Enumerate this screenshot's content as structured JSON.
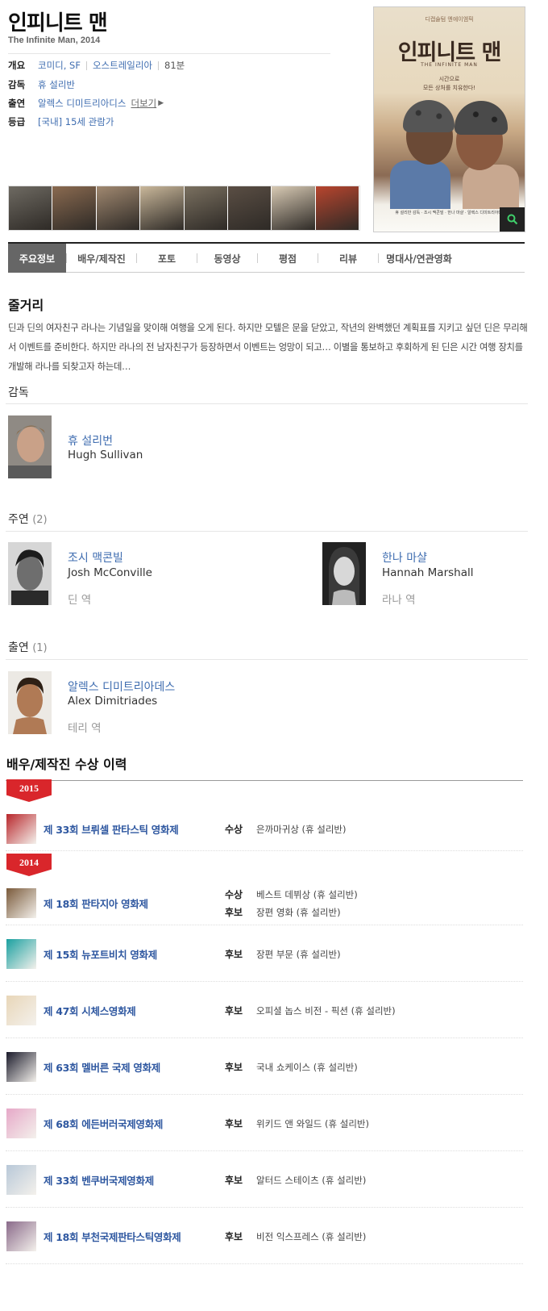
{
  "header": {
    "title": "인피니트 맨",
    "subtitle": "The Infinite Man, 2014"
  },
  "info": {
    "overview_label": "개요",
    "genre": "코미디, SF",
    "country": "오스트레일리아",
    "runtime": "81분",
    "director_label": "감독",
    "director": "휴 설리반",
    "cast_label": "출연",
    "cast": "알렉스 디미트리아디스",
    "more": "더보기",
    "rating_label": "등급",
    "rating": "[국내] 15세 관람가"
  },
  "poster": {
    "top_caption": "디캡슐텀  엔에이엠픽",
    "title": "인피니트 맨",
    "en_title": "THE INFINITE MAN",
    "tagline": "시간으로\n모든 상처를 치유한다!",
    "credits": "휴 설리반 감독 · 조시 맥콘빌 · 한나 마샬 · 알렉스 디미트리아데스"
  },
  "thumbnails": [
    {
      "color": "#6e6a62"
    },
    {
      "color": "#8a6a50"
    },
    {
      "color": "#a08870"
    },
    {
      "color": "#c9b79a"
    },
    {
      "color": "#7a7060"
    },
    {
      "color": "#5a4e44"
    },
    {
      "color": "#d8cab4"
    },
    {
      "color": "#b8452e"
    }
  ],
  "tabs": [
    {
      "label": "주요정보",
      "active": true
    },
    {
      "label": "배우/제작진"
    },
    {
      "label": "포토"
    },
    {
      "label": "동영상"
    },
    {
      "label": "평점"
    },
    {
      "label": "리뷰"
    },
    {
      "label": "명대사/연관영화"
    }
  ],
  "synopsis": {
    "heading": "줄거리",
    "text": "딘과 딘의 여자친구 라나는 기념일을 맞이해 여행을 오게 된다. 하지만 모텔은 문을 닫았고, 작년의 완벽했던 계획표를 지키고 싶던 딘은 무리해서 이벤트를 준비한다. 하지만 라나의 전 남자친구가 등장하면서 이벤트는 엉망이 되고… 이별을 통보하고 후회하게 된 딘은 시간 여행 장치를 개발해 라나를 되찾고자 하는데…"
  },
  "director_section": {
    "heading": "감독",
    "people": [
      {
        "name_ko": "휴 설리번",
        "name_en": "Hugh Sullivan"
      }
    ]
  },
  "lead_section": {
    "heading": "주연",
    "count": "(2)",
    "people": [
      {
        "name_ko": "조시 맥콘빌",
        "name_en": "Josh McConville",
        "role": "딘 역"
      },
      {
        "name_ko": "한나 마샬",
        "name_en": "Hannah Marshall",
        "role": "라나 역"
      }
    ]
  },
  "cast_section": {
    "heading": "출연",
    "count": "(1)",
    "people": [
      {
        "name_ko": "알렉스 디미트리아데스",
        "name_en": "Alex Dimitriades",
        "role": "테리 역"
      }
    ]
  },
  "awards": {
    "heading": "배우/제작진 수상 이력",
    "years": [
      {
        "year": "2015",
        "festivals": [
          {
            "name": "제 33회 브뤼셀 판타스틱 영화제",
            "items": [
              {
                "type": "수상",
                "desc": "은까마귀상 (휴 설리반)"
              }
            ]
          }
        ]
      },
      {
        "year": "2014",
        "festivals": [
          {
            "name": "제 18회 판타지아 영화제",
            "items": [
              {
                "type": "수상",
                "desc": "베스트 데뷔상 (휴 설리반)"
              },
              {
                "type": "후보",
                "desc": "장편 영화 (휴 설리반)"
              }
            ]
          },
          {
            "name": "제 15회 뉴포트비치 영화제",
            "items": [
              {
                "type": "후보",
                "desc": "장편 부문 (휴 설리반)"
              }
            ]
          },
          {
            "name": "제 47회 시체스영화제",
            "items": [
              {
                "type": "후보",
                "desc": "오피셜 놉스 비전 - 픽션 (휴 설리반)"
              }
            ]
          },
          {
            "name": "제 63회 멜버른 국제 영화제",
            "items": [
              {
                "type": "후보",
                "desc": "국내 쇼케이스 (휴 설리반)"
              }
            ]
          },
          {
            "name": "제 68회 에든버러국제영화제",
            "items": [
              {
                "type": "후보",
                "desc": "위키드 앤 와일드 (휴 설리반)"
              }
            ]
          },
          {
            "name": "제 33회 벤쿠버국제영화제",
            "items": [
              {
                "type": "후보",
                "desc": "알터드 스테이츠 (휴 설리반)"
              }
            ]
          },
          {
            "name": "제 18회 부천국제판타스틱영화제",
            "items": [
              {
                "type": "후보",
                "desc": "비전 익스프레스 (휴 설리반)"
              }
            ]
          }
        ]
      }
    ]
  },
  "colors": {
    "link": "#3f6db0",
    "festival": "#2e57a0",
    "year_badge": "#d9262b",
    "active_tab": "#666666"
  }
}
